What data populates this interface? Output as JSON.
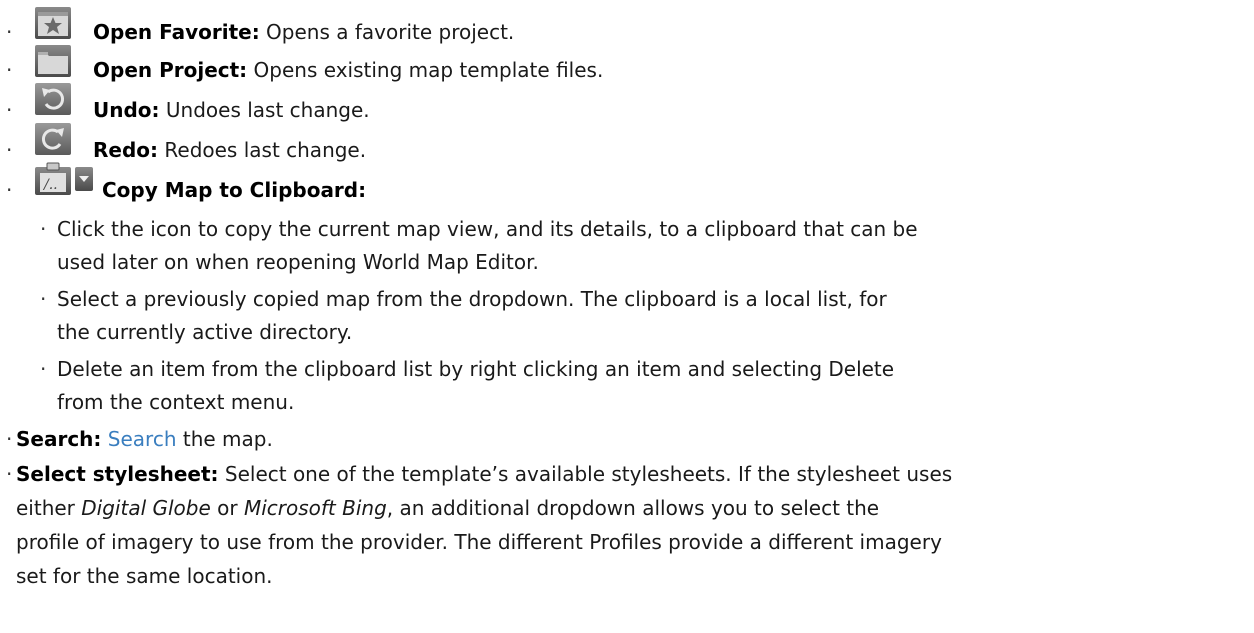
{
  "items": [
    {
      "term": "Open Favorite:",
      "desc": " Opens a favorite project.",
      "icon": "favorite-star-icon"
    },
    {
      "term": "Open Project:",
      "desc": " Opens existing map template files.",
      "icon": "folder-icon"
    },
    {
      "term": "Undo:",
      "desc": " Undoes last change.",
      "icon": "undo-icon"
    },
    {
      "term": "Redo:",
      "desc": " Redoes last change.",
      "icon": "redo-icon"
    },
    {
      "term": "Copy Map to Clipboard:",
      "icon": "clipboard-icon",
      "dropdown_icon": "dropdown-arrow-icon"
    }
  ],
  "clipboard_subitems": [
    {
      "line1": "Click the icon to copy the current map view, and its details, to a clipboard that can be",
      "line2": "used later on when reopening World Map Editor."
    },
    {
      "line1": "Select a previously copied map from the dropdown. The clipboard is a local list, for",
      "line2": "the currently active directory."
    },
    {
      "line1": "Delete an item from the clipboard list by right clicking an item and selecting Delete",
      "line2": "from the context menu."
    }
  ],
  "search": {
    "term": "Search:",
    "link": "Search",
    "desc": " the map."
  },
  "stylesheet": {
    "term": "Select stylesheet:",
    "line1_desc": " Select one of the template’s available stylesheets. If the stylesheet uses",
    "line2_pre": "either ",
    "line2_em1": "Digital Globe",
    "line2_mid": " or ",
    "line2_em2": "Microsoft Bing",
    "line2_post": ", an additional dropdown allows you to select the",
    "line3": "profile of imagery to use from the provider. The different Profiles provide a different imagery",
    "line4": "set for the same location."
  },
  "bullet_char": "·",
  "colors": {
    "link": "#3a7ebf",
    "text": "#1a1a1a",
    "icon_dark": "#5a5a5a"
  }
}
